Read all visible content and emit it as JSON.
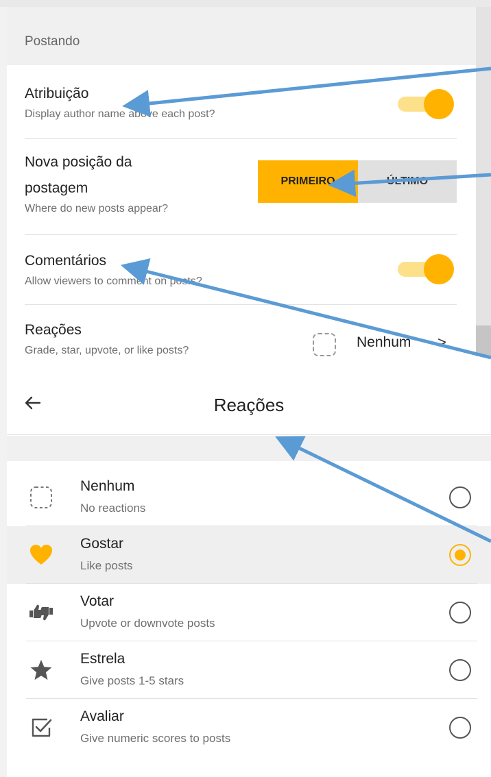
{
  "posting_section": {
    "header": "Postando",
    "attribution": {
      "title": "Atribuição",
      "subtitle": "Display author name above each post?",
      "enabled": true
    },
    "new_post_position": {
      "title_line1": "Nova posição da",
      "title_line2": "postagem",
      "subtitle": "Where do new posts appear?",
      "options": [
        "PRIMEIRO",
        "ÚLTIMO"
      ],
      "selected": "PRIMEIRO"
    },
    "comments": {
      "title": "Comentários",
      "subtitle": "Allow viewers to comment on posts?",
      "enabled": true
    },
    "reactions": {
      "title": "Reações",
      "subtitle": "Grade, star, upvote, or like posts?",
      "value": "Nenhum",
      "chevron": ">"
    }
  },
  "reactions_screen": {
    "title": "Reações",
    "back_icon": "arrow-left-icon",
    "options": [
      {
        "title": "Nenhum",
        "subtitle": "No reactions",
        "icon": "dashed-square-icon",
        "selected": false
      },
      {
        "title": "Gostar",
        "subtitle": "Like posts",
        "icon": "heart-icon",
        "selected": true
      },
      {
        "title": "Votar",
        "subtitle": "Upvote or downvote posts",
        "icon": "thumbs-up-down-icon",
        "selected": false
      },
      {
        "title": "Estrela",
        "subtitle": "Give posts 1-5 stars",
        "icon": "star-icon",
        "selected": false
      },
      {
        "title": "Avaliar",
        "subtitle": "Give numeric scores to posts",
        "icon": "checkbox-icon",
        "selected": false
      }
    ]
  },
  "colors": {
    "accent": "#ffb300",
    "accent_light": "#fde08a",
    "arrow": "#5b9bd5"
  }
}
